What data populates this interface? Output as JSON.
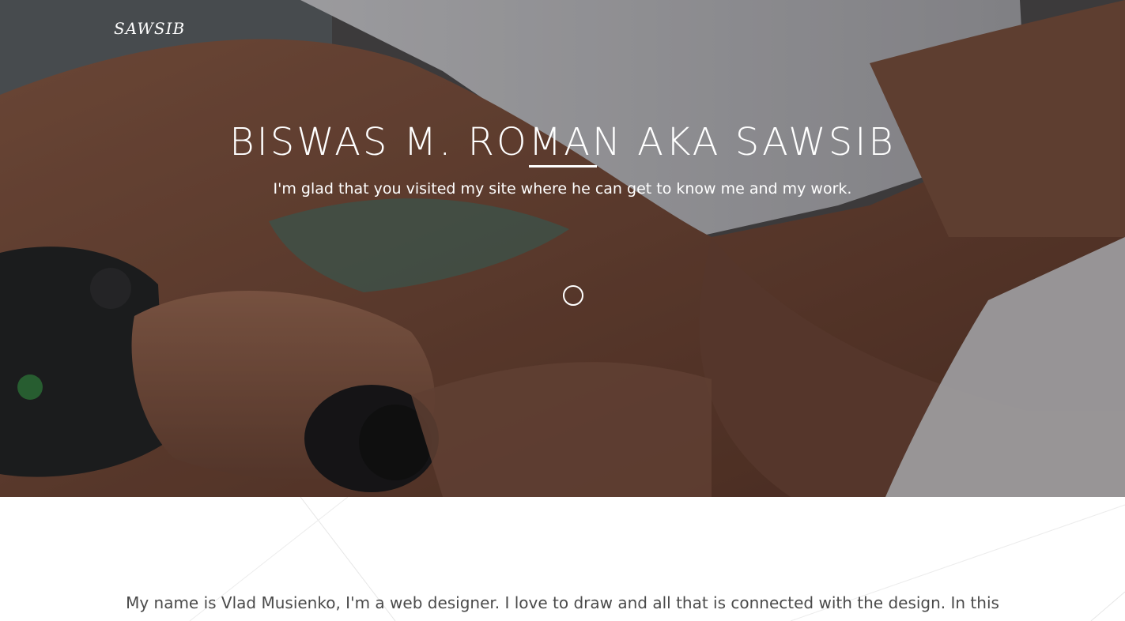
{
  "brand": {
    "logo_text": "SAWSIB"
  },
  "hero": {
    "title": "BISWAS M. ROMAN AKA SAWSIB",
    "subtitle": "I'm glad that you visited my site where he can get to know me and my work.",
    "background_icon": "camera-hands-photo",
    "scroll_icon": "circle-scroll-icon"
  },
  "about": {
    "text": "My name is Vlad Musienko, I'm a web designer. I love to draw and all that is connected with the design. In this"
  },
  "colors": {
    "hero_text": "#ffffff",
    "body_text": "#4a4a4a",
    "background": "#ffffff"
  }
}
